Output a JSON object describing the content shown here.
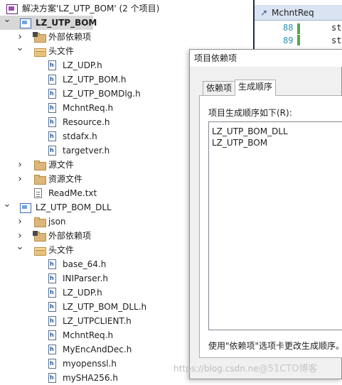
{
  "solution": {
    "label": "解决方案'LZ_UTP_BOM' (2 个项目)"
  },
  "tree": [
    {
      "name": "project-lz-utp-bom",
      "label": "LZ_UTP_BOM",
      "icon": "project-icon",
      "level": 0,
      "arrow": "expanded",
      "selected": true
    },
    {
      "name": "folder-external-deps",
      "label": "外部依赖项",
      "icon": "external-deps-icon",
      "level": 1,
      "arrow": "collapsed"
    },
    {
      "name": "folder-header-files",
      "label": "头文件",
      "icon": "folder-open-icon",
      "level": 1,
      "arrow": "expanded"
    },
    {
      "name": "file-lz-udp-h",
      "label": "LZ_UDP.h",
      "icon": "header-file-icon",
      "level": 2
    },
    {
      "name": "file-lz-utp-bom-h",
      "label": "LZ_UTP_BOM.h",
      "icon": "header-file-icon",
      "level": 2
    },
    {
      "name": "file-lz-utp-bomdlg-h",
      "label": "LZ_UTP_BOMDlg.h",
      "icon": "header-file-icon",
      "level": 2
    },
    {
      "name": "file-mchntreq-h",
      "label": "MchntReq.h",
      "icon": "header-file-icon",
      "level": 2
    },
    {
      "name": "file-resource-h",
      "label": "Resource.h",
      "icon": "header-file-icon",
      "level": 2
    },
    {
      "name": "file-stdafx-h",
      "label": "stdafx.h",
      "icon": "header-file-icon",
      "level": 2
    },
    {
      "name": "file-targetver-h",
      "label": "targetver.h",
      "icon": "header-file-icon",
      "level": 2
    },
    {
      "name": "folder-source-files",
      "label": "源文件",
      "icon": "folder-icon",
      "level": 1,
      "arrow": "collapsed"
    },
    {
      "name": "folder-resource-files",
      "label": "资源文件",
      "icon": "folder-icon",
      "level": 1,
      "arrow": "collapsed"
    },
    {
      "name": "file-readme-txt",
      "label": "ReadMe.txt",
      "icon": "text-file-icon",
      "level": 1
    },
    {
      "name": "project-lz-utp-bom-dll",
      "label": "LZ_UTP_BOM_DLL",
      "icon": "project-icon",
      "level": 0,
      "arrow": "expanded"
    },
    {
      "name": "folder-json",
      "label": "json",
      "icon": "folder-icon",
      "level": 1,
      "arrow": "collapsed"
    },
    {
      "name": "folder-external-deps-2",
      "label": "外部依赖项",
      "icon": "external-deps-icon",
      "level": 1,
      "arrow": "collapsed"
    },
    {
      "name": "folder-header-files-2",
      "label": "头文件",
      "icon": "folder-open-icon",
      "level": 1,
      "arrow": "expanded"
    },
    {
      "name": "file-base64-h",
      "label": "base_64.h",
      "icon": "header-file-icon",
      "level": 2
    },
    {
      "name": "file-iniparser-h",
      "label": "INIParser.h",
      "icon": "header-file-icon",
      "level": 2
    },
    {
      "name": "file-lz-udp-h-2",
      "label": "LZ_UDP.h",
      "icon": "header-file-icon",
      "level": 2
    },
    {
      "name": "file-lz-utp-bom-dll-h",
      "label": "LZ_UTP_BOM_DLL.h",
      "icon": "header-file-icon",
      "level": 2
    },
    {
      "name": "file-lz-utpclient-h",
      "label": "LZ_UTPCLIENT.h",
      "icon": "header-file-icon",
      "level": 2
    },
    {
      "name": "file-mchntreq-h-2",
      "label": "MchntReq.h",
      "icon": "header-file-icon",
      "level": 2
    },
    {
      "name": "file-myencanddec-h",
      "label": "MyEncAndDec.h",
      "icon": "header-file-icon",
      "level": 2
    },
    {
      "name": "file-myopenssl-h",
      "label": "myopenssl.h",
      "icon": "header-file-icon",
      "level": 2
    },
    {
      "name": "file-mysha256-h",
      "label": "mySHA256.h",
      "icon": "header-file-icon",
      "level": 2
    }
  ],
  "editor": {
    "tab_label": "MchntReq",
    "lines": [
      {
        "num": "88",
        "code": "st"
      },
      {
        "num": "89",
        "code": "st"
      }
    ]
  },
  "dialog": {
    "title": "项目依赖项",
    "tabs": [
      "依赖项",
      "生成顺序"
    ],
    "active_tab": 1,
    "order_label": "项目生成顺序如下(R):",
    "order_items": [
      "LZ_UTP_BOM_DLL",
      "LZ_UTP_BOM"
    ],
    "hint": "使用\"依赖项\"选项卡更改生成顺序。"
  },
  "watermark": {
    "url": "https://blog.csdn.ne",
    "brand": "@51CTO博客"
  },
  "colors": {
    "selected_row": "#d7d7d7",
    "dialog_bg": "#f0f0f0",
    "editor_tab_bg": "#d9e3f2",
    "line_number": "#2b91af",
    "change_bar": "#57a64a"
  }
}
